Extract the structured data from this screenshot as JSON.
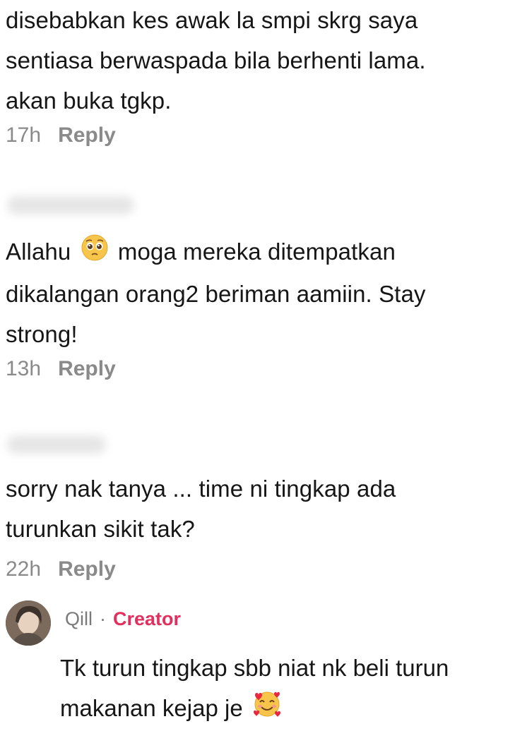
{
  "comments": [
    {
      "text_lines": [
        "disebabkan kes awak la smpi skrg saya",
        "sentiasa berwaspada bila berhenti lama.",
        "akan buka tgkp."
      ],
      "time": "17h",
      "reply_label": "Reply"
    },
    {
      "text_before_emoji": "Allahu",
      "emoji": "pleading-face",
      "text_after_emoji": "moga mereka ditempatkan",
      "text_lines_rest": [
        "dikalangan orang2 beriman aamiin. Stay",
        "strong!"
      ],
      "time": "13h",
      "reply_label": "Reply"
    },
    {
      "text_lines": [
        "sorry nak tanya ... time ni tingkap ada",
        "turunkan sikit tak?"
      ],
      "time": "22h",
      "reply_label": "Reply"
    }
  ],
  "creator_reply": {
    "username": "Qill",
    "separator": "·",
    "badge": "Creator",
    "text_lines": [
      "Tk turun tingkap sbb niat nk beli turun",
      "makanan kejap je"
    ],
    "emoji": "smiling-face-with-hearts"
  },
  "colors": {
    "creator_badge": "#e22f5e",
    "meta_gray": "#8a8a8a",
    "text": "#161616"
  }
}
